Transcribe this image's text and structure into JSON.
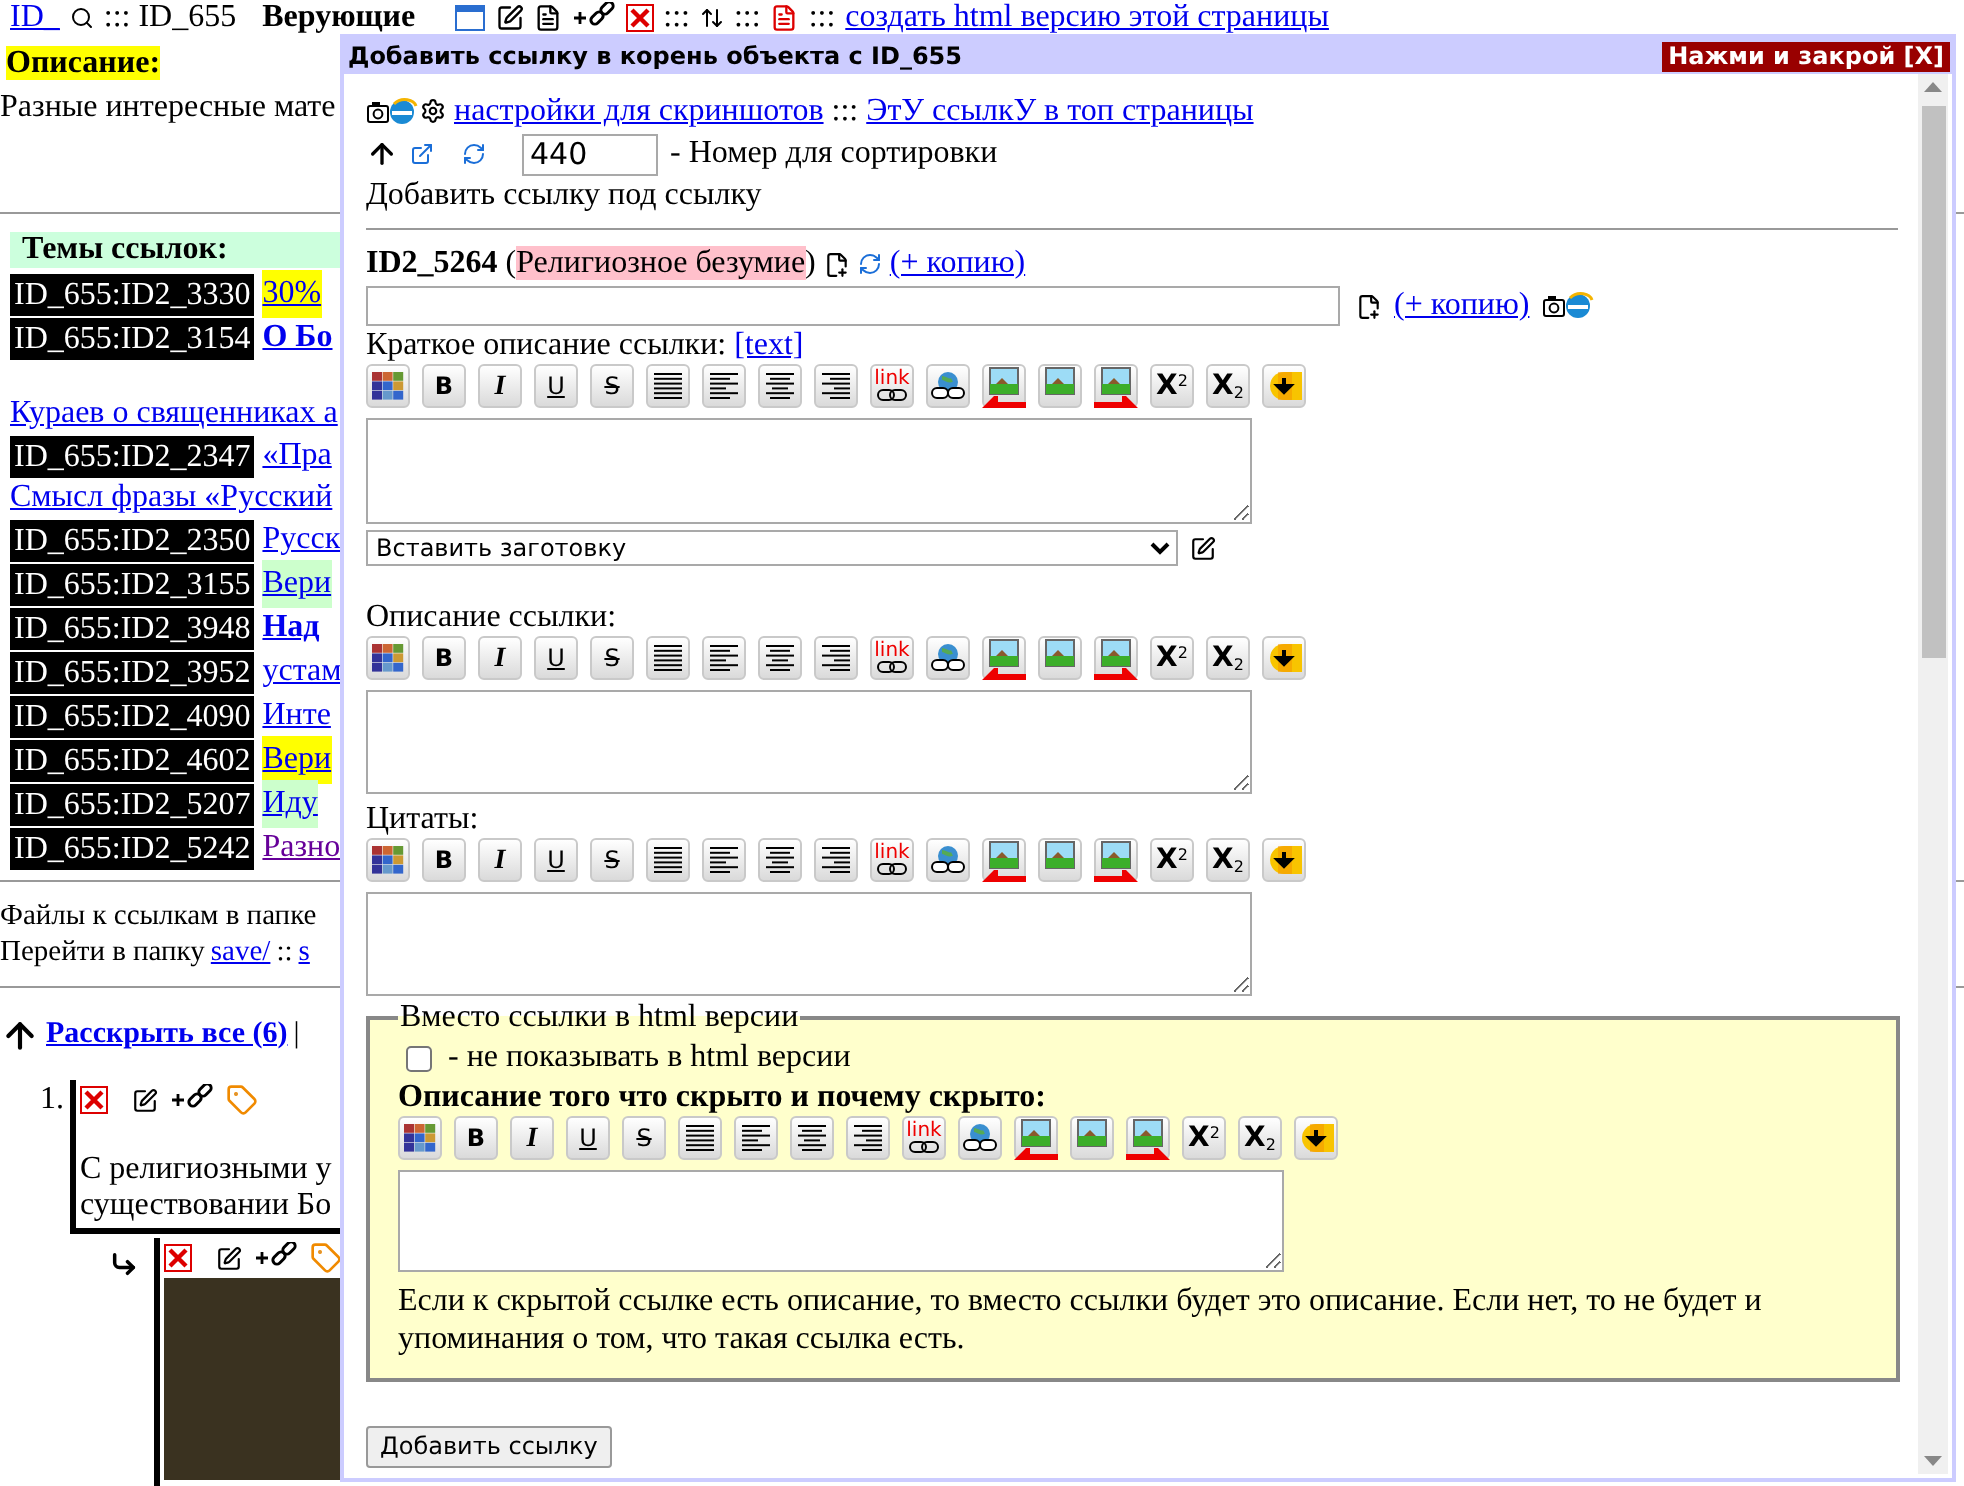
{
  "background": {
    "header": {
      "id_link": "ID_",
      "id_label": "::: ID_655",
      "title": "Верующие",
      "sep_1": ":::",
      "sep_2": ":::",
      "sep_3": ":::",
      "html_link": "создать html версию этой страницы"
    },
    "description_label": "Описание:",
    "description_text": "Разные интересные мате",
    "topics_label": "Темы ссылок:",
    "topics": [
      {
        "kind": "id",
        "id": "ID_655:ID2_3330",
        "text": "30%",
        "color": "#ffff00",
        "bold": false,
        "visited": false
      },
      {
        "kind": "id",
        "id": "ID_655:ID2_3154",
        "text": "О Бо",
        "bold": true,
        "visited": false
      },
      {
        "kind": "gap"
      },
      {
        "kind": "link",
        "text": "Кураев о священниках а",
        "bold": false,
        "visited": false
      },
      {
        "kind": "id",
        "id": "ID_655:ID2_2347",
        "text": "«Пра",
        "bold": false,
        "visited": false
      },
      {
        "kind": "link",
        "text": "Смысл фразы «Русский",
        "bold": false,
        "visited": false
      },
      {
        "kind": "id",
        "id": "ID_655:ID2_2350",
        "text": "Русск",
        "bold": false,
        "visited": false
      },
      {
        "kind": "id",
        "id": "ID_655:ID2_3155",
        "text": "Вери",
        "color": "#ccffcc",
        "bold": false,
        "visited": false
      },
      {
        "kind": "id",
        "id": "ID_655:ID2_3948",
        "text": "Над",
        "bold": true,
        "visited": false
      },
      {
        "kind": "id",
        "id": "ID_655:ID2_3952",
        "text": "устам",
        "bold": false,
        "visited": false
      },
      {
        "kind": "id",
        "id": "ID_655:ID2_4090",
        "text": "Инте",
        "bold": false,
        "visited": false
      },
      {
        "kind": "id",
        "id": "ID_655:ID2_4602",
        "text": "Вери",
        "color": "#ffff00",
        "bold": false,
        "visited": false
      },
      {
        "kind": "id",
        "id": "ID_655:ID2_5207",
        "text": "Иду",
        "color": "#ccffcc",
        "bold": false,
        "visited": false
      },
      {
        "kind": "id",
        "id": "ID_655:ID2_5242",
        "text": "Разно",
        "bold": false,
        "visited": true
      }
    ],
    "files_text": "Файлы к ссылкам в папке",
    "folder": {
      "text": "Перейти в папку",
      "link_1": "save/",
      "sep": "::",
      "link_2": "s"
    },
    "expand_link": "Расскрыть все (6)",
    "expand_sep": "|",
    "entry": {
      "number": "1.",
      "lines": [
        "С религиозными у",
        "существовании Бо"
      ]
    }
  },
  "dialog": {
    "title": "Добавить ссылку в корень объекта с ID_655",
    "close": "Нажми и закрой [X]",
    "settings_link": "настройки для скриншотов",
    "sep": ":::",
    "top_link": "ЭтУ ссылкУ в топ страницы",
    "sort": {
      "value": "440",
      "label": "- Номер для сортировки"
    },
    "add_under": "Добавить ссылку под ссылку",
    "record": {
      "id": "ID2_5264",
      "open": "(",
      "topic": "Религиозное безумие",
      "close": ")",
      "copy_link": "(+ копию)"
    },
    "url_field": {
      "copy_link": "(+ копию)"
    },
    "short_desc": {
      "label": "Краткое описание ссылки:",
      "link": "[text]",
      "toolbar": [
        {
          "kind": "palette"
        },
        {
          "kind": "bold",
          "label": "B"
        },
        {
          "kind": "italic",
          "label": "I"
        },
        {
          "kind": "underline",
          "label": "U"
        },
        {
          "kind": "strike",
          "label": "S"
        },
        {
          "kind": "justify"
        },
        {
          "kind": "left"
        },
        {
          "kind": "center"
        },
        {
          "kind": "right"
        },
        {
          "kind": "link",
          "label": "link"
        },
        {
          "kind": "weblink"
        },
        {
          "kind": "image_left"
        },
        {
          "kind": "image"
        },
        {
          "kind": "image_right"
        },
        {
          "kind": "sup",
          "label": "X",
          "index": "2"
        },
        {
          "kind": "sub",
          "label": "X",
          "index": "2"
        },
        {
          "kind": "insert"
        }
      ]
    },
    "preset": {
      "value": "Вставить заготовку"
    },
    "description": {
      "label": "Описание ссылки:",
      "toolbar": [
        {
          "kind": "palette"
        },
        {
          "kind": "bold",
          "label": "B"
        },
        {
          "kind": "italic",
          "label": "I"
        },
        {
          "kind": "underline",
          "label": "U"
        },
        {
          "kind": "strike",
          "label": "S"
        },
        {
          "kind": "justify"
        },
        {
          "kind": "left"
        },
        {
          "kind": "center"
        },
        {
          "kind": "right"
        },
        {
          "kind": "link",
          "label": "link"
        },
        {
          "kind": "weblink"
        },
        {
          "kind": "image_left"
        },
        {
          "kind": "image"
        },
        {
          "kind": "image_right"
        },
        {
          "kind": "sup",
          "label": "X",
          "index": "2"
        },
        {
          "kind": "sub",
          "label": "X",
          "index": "2"
        },
        {
          "kind": "insert"
        }
      ]
    },
    "quotes": {
      "label": "Цитаты:",
      "toolbar": [
        {
          "kind": "palette"
        },
        {
          "kind": "bold",
          "label": "B"
        },
        {
          "kind": "italic",
          "label": "I"
        },
        {
          "kind": "underline",
          "label": "U"
        },
        {
          "kind": "strike",
          "label": "S"
        },
        {
          "kind": "justify"
        },
        {
          "kind": "left"
        },
        {
          "kind": "center"
        },
        {
          "kind": "right"
        },
        {
          "kind": "link",
          "label": "link"
        },
        {
          "kind": "weblink"
        },
        {
          "kind": "image_left"
        },
        {
          "kind": "image"
        },
        {
          "kind": "image_right"
        },
        {
          "kind": "sup",
          "label": "X",
          "index": "2"
        },
        {
          "kind": "sub",
          "label": "X",
          "index": "2"
        },
        {
          "kind": "insert"
        }
      ]
    },
    "hidden": {
      "legend": "Вместо ссылки в html версии",
      "checked": false,
      "checkbox_label": "- не показывать в html версии",
      "label": "Описание того что скрыто и почему скрыто:",
      "toolbar": [
        {
          "kind": "palette"
        },
        {
          "kind": "bold",
          "label": "B"
        },
        {
          "kind": "italic",
          "label": "I"
        },
        {
          "kind": "underline",
          "label": "U"
        },
        {
          "kind": "strike",
          "label": "S"
        },
        {
          "kind": "justify"
        },
        {
          "kind": "left"
        },
        {
          "kind": "center"
        },
        {
          "kind": "right"
        },
        {
          "kind": "link",
          "label": "link"
        },
        {
          "kind": "weblink"
        },
        {
          "kind": "image_left"
        },
        {
          "kind": "image"
        },
        {
          "kind": "image_right"
        },
        {
          "kind": "sup",
          "label": "X",
          "index": "2"
        },
        {
          "kind": "sub",
          "label": "X",
          "index": "2"
        },
        {
          "kind": "insert"
        }
      ],
      "note": "Если к скрытой ссылке есть описание, то вместо ссылки будет это описание. Если нет, то не будет и упоминания о том, что такая ссылка есть."
    },
    "submit": "Добавить ссылку"
  }
}
